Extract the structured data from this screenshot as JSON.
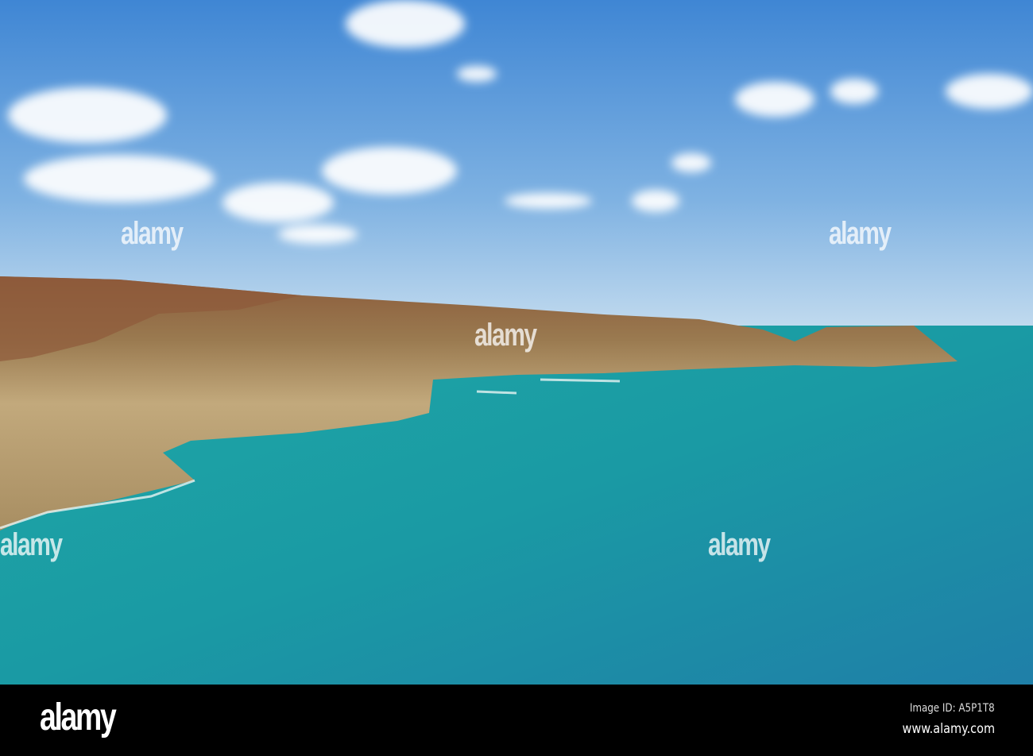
{
  "footer": {
    "logo": "alamy",
    "image_id": "Image ID: A5P1T8",
    "url": "www.alamy.com"
  },
  "watermark": "alamy",
  "colors": {
    "sky_top": "#3f8ad6",
    "sky_bottom": "#b9d6ee",
    "sea_near": "#1aa3a0",
    "sea_far": "#1f82a8",
    "cliff": "#b59a6e",
    "heath": "#8a5a3a"
  }
}
